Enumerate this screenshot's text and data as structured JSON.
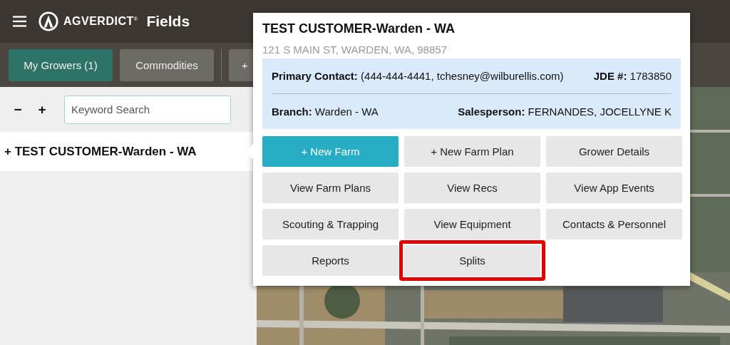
{
  "header": {
    "brand": "AGVERDICT",
    "brand_mark": "®",
    "title": "Fields"
  },
  "toolbar": [
    {
      "label": "My Growers (1)",
      "selected": true
    },
    {
      "label": "Commodities",
      "selected": false
    },
    {
      "label": "+",
      "selected": false
    }
  ],
  "sidebar": {
    "zoom_out": "−",
    "zoom_in": "+",
    "search": {
      "placeholder": "Keyword Search"
    },
    "items": [
      {
        "label": "+ TEST CUSTOMER-Warden - WA",
        "selected": true
      }
    ]
  },
  "popup": {
    "title": "TEST CUSTOMER-Warden - WA",
    "address": "121 S MAIN ST, WARDEN, WA, 98857",
    "info": [
      [
        "**Primary Contact:** (444-444-4441, tchesney@wilburellis.com)",
        "**JDE #:** 1783850"
      ],
      [
        "**Branch:** Warden - WA",
        "**Salesperson:** FERNANDES, JOCELLYNE K"
      ]
    ],
    "buttons": [
      {
        "label": "+ New Farm",
        "kind": "primary",
        "highlighted": false
      },
      {
        "label": "+ New Farm Plan",
        "kind": "default",
        "highlighted": false
      },
      {
        "label": "Grower Details",
        "kind": "default",
        "highlighted": false
      },
      {
        "label": "View Farm Plans",
        "kind": "default",
        "highlighted": false
      },
      {
        "label": "View Recs",
        "kind": "default",
        "highlighted": false
      },
      {
        "label": "View App Events",
        "kind": "default",
        "highlighted": false
      },
      {
        "label": "Scouting & Trapping",
        "kind": "default",
        "highlighted": false
      },
      {
        "label": "View Equipment",
        "kind": "default",
        "highlighted": false
      },
      {
        "label": "Contacts & Personnel",
        "kind": "default",
        "highlighted": false
      },
      {
        "label": "Reports",
        "kind": "default",
        "highlighted": false
      },
      {
        "label": "Splits",
        "kind": "default",
        "highlighted": true
      }
    ]
  }
}
